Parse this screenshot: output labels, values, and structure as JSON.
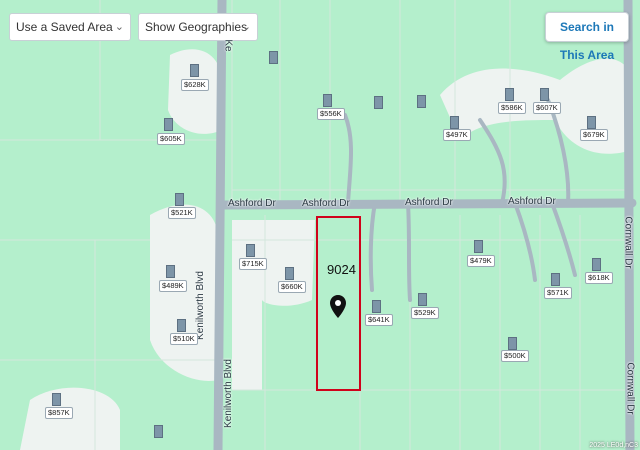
{
  "controls": {
    "saved_area_label": "Use a Saved Area",
    "geographies_label": "Show Geographies",
    "search_button": "Search in This Area"
  },
  "streets": {
    "ashford_1": "Ashford Dr",
    "ashford_2": "Ashford Dr",
    "ashford_3": "Ashford Dr",
    "ashford_4": "Ashford Dr",
    "kenilworth": "Kenilworth Blvd",
    "cornwall_1": "Cornwall Dr",
    "cornwall_2": "Cornwall Dr",
    "kenilworth_top": "Ke"
  },
  "selected_lot": {
    "id": "9024",
    "outline_color": "#d0021b"
  },
  "listings": [
    "$628K",
    "$556K",
    "$586K",
    "$607K",
    "$497K",
    "$679K",
    "$605K",
    "$521K",
    "$715K",
    "$660K",
    "$641K",
    "$529K",
    "$479K",
    "$571K",
    "$618K",
    "$489K",
    "$510K",
    "$500K",
    "$857K"
  ],
  "colors": {
    "map_green": "#b4efcc",
    "developed_area": "#ecf2f0",
    "road": "#a9b7c2",
    "accent_blue": "#1d78b8"
  },
  "watermark": "2025 LE0d,nC3"
}
